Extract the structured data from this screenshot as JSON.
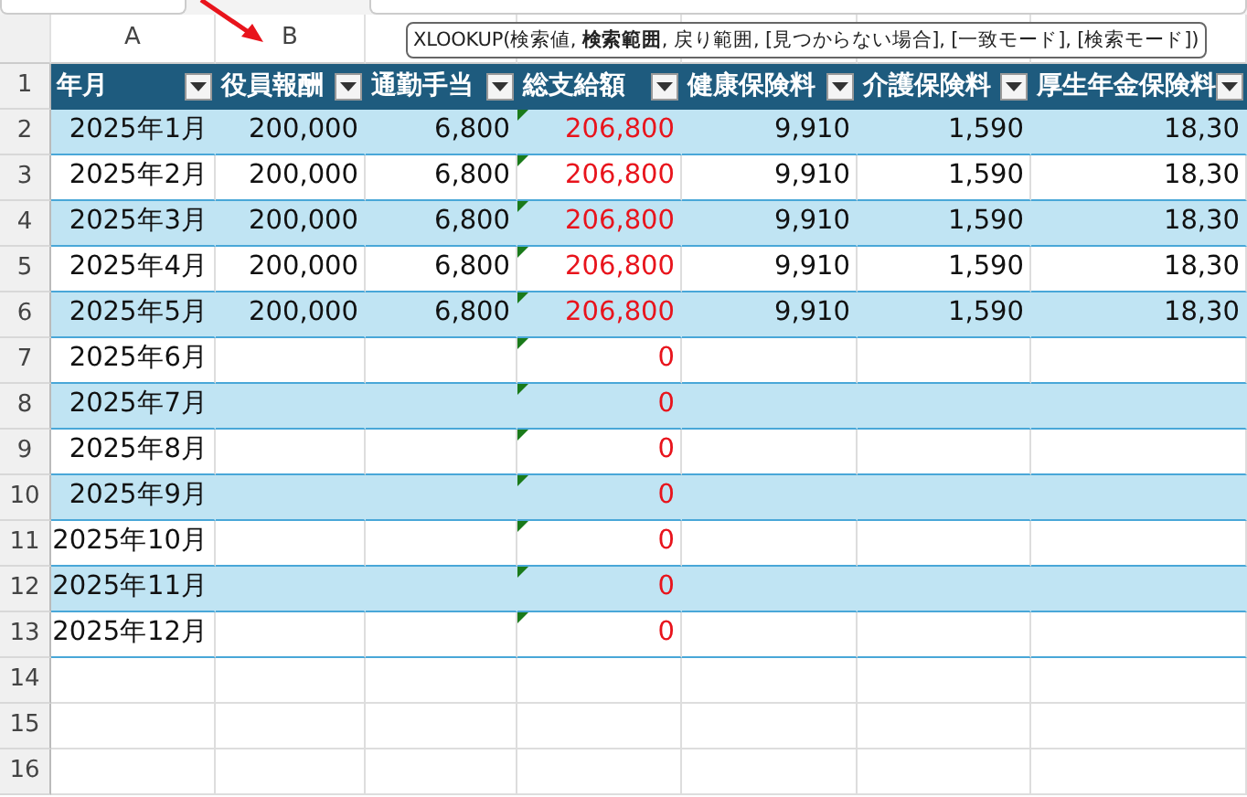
{
  "column_headers": [
    {
      "label": "A"
    },
    {
      "label": "B"
    }
  ],
  "formula_tooltip": "XLOOKUP(検索値, **検索範囲**, 戻り範囲, [見つからない場合], [一致モード], [検索モード])",
  "table": {
    "columns": [
      {
        "label": "年月"
      },
      {
        "label": "役員報酬"
      },
      {
        "label": "通勤手当"
      },
      {
        "label": "総支給額"
      },
      {
        "label": "健康保険料"
      },
      {
        "label": "介護保険料"
      },
      {
        "label": "厚生年金保険料"
      }
    ],
    "header_row_number": "1",
    "rows": [
      {
        "number": "2",
        "flagged": true,
        "cells": [
          "2025年1月",
          "200,000",
          "6,800",
          "206,800",
          "9,910",
          "1,590",
          "18,30"
        ]
      },
      {
        "number": "3",
        "flagged": true,
        "cells": [
          "2025年2月",
          "200,000",
          "6,800",
          "206,800",
          "9,910",
          "1,590",
          "18,30"
        ]
      },
      {
        "number": "4",
        "flagged": true,
        "cells": [
          "2025年3月",
          "200,000",
          "6,800",
          "206,800",
          "9,910",
          "1,590",
          "18,30"
        ]
      },
      {
        "number": "5",
        "flagged": true,
        "cells": [
          "2025年4月",
          "200,000",
          "6,800",
          "206,800",
          "9,910",
          "1,590",
          "18,30"
        ]
      },
      {
        "number": "6",
        "flagged": true,
        "cells": [
          "2025年5月",
          "200,000",
          "6,800",
          "206,800",
          "9,910",
          "1,590",
          "18,30"
        ]
      },
      {
        "number": "7",
        "flagged": true,
        "cells": [
          "2025年6月",
          "",
          "",
          "0",
          "",
          "",
          ""
        ]
      },
      {
        "number": "8",
        "flagged": true,
        "cells": [
          "2025年7月",
          "",
          "",
          "0",
          "",
          "",
          ""
        ]
      },
      {
        "number": "9",
        "flagged": true,
        "cells": [
          "2025年8月",
          "",
          "",
          "0",
          "",
          "",
          ""
        ]
      },
      {
        "number": "10",
        "flagged": true,
        "cells": [
          "2025年9月",
          "",
          "",
          "0",
          "",
          "",
          ""
        ]
      },
      {
        "number": "11",
        "flagged": true,
        "cells": [
          "2025年10月",
          "",
          "",
          "0",
          "",
          "",
          ""
        ]
      },
      {
        "number": "12",
        "flagged": true,
        "cells": [
          "2025年11月",
          "",
          "",
          "0",
          "",
          "",
          ""
        ]
      },
      {
        "number": "13",
        "flagged": true,
        "cells": [
          "2025年12月",
          "",
          "",
          "0",
          "",
          "",
          ""
        ]
      }
    ]
  },
  "empty_rows": [
    {
      "number": "14"
    },
    {
      "number": "15"
    },
    {
      "number": "16"
    }
  ]
}
